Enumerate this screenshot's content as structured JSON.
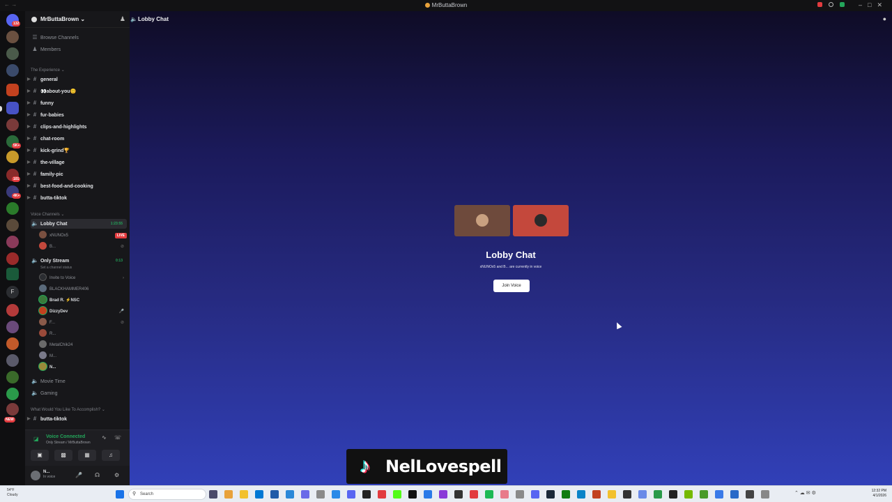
{
  "window": {
    "title": "MrButtaBrown"
  },
  "rail_badges": [
    {
      "id": "b1",
      "text": "132"
    },
    {
      "id": "b2",
      "text": "5K+"
    },
    {
      "id": "b3",
      "text": "101"
    },
    {
      "id": "b4",
      "text": "4K+"
    },
    {
      "id": "b5",
      "text": "NEW"
    }
  ],
  "server": {
    "name": "MrButtaBrown",
    "browse": "Browse Channels",
    "members": "Members",
    "cat1": "The Experience",
    "text_channels": [
      "general",
      "👀about-you😊",
      "funny",
      "fur-babies",
      "clips-and-highlights",
      "chat-room",
      "kick-grind🏆",
      "the-village",
      "family-pic",
      "best-food-and-cooking",
      "butta-tiktok"
    ],
    "cat2": "Voice Channels",
    "lobby": {
      "name": "Lobby Chat",
      "timer": "1:23:55"
    },
    "lobby_users": [
      {
        "name": "xNUNOx5",
        "live": "LIVE"
      },
      {
        "name": "B..."
      }
    ],
    "only_stream": {
      "name": "Only Stream",
      "timer": "0:13",
      "status": "Set a channel status"
    },
    "invite": "Invite to Voice",
    "stream_users": [
      "BLACKHAMMER406",
      "Brad R. ⚡NSC",
      "DizzyDev",
      "F...",
      "R...",
      "MetalChik24",
      "M...",
      "N..."
    ],
    "movie": "Movie Time",
    "gaming": "Gaming",
    "cat3": "What Would You Like To Accomplish?",
    "last_channel": "butta-tiktok"
  },
  "voice": {
    "status": "Voice Connected",
    "sub": "Only Stream / MrButtaBrown"
  },
  "user": {
    "name": "N...",
    "status": "In voice"
  },
  "main": {
    "channel_title": "Lobby Chat",
    "stage_title": "Lobby Chat",
    "subtitle": "xNUNOx5 and B... are currently in voice",
    "join_label": "Join Voice"
  },
  "watermark": "NelLovespell",
  "taskbar": {
    "weather_temp": "54°F",
    "weather_desc": "Cloudy",
    "search": "Search",
    "time": "12:32 PM",
    "date": "4/1/2026"
  },
  "colors": {
    "live": "#e23b3f",
    "connected": "#23a55a",
    "tile_left": "#6e4a3c",
    "tile_right": "#c4483c"
  }
}
